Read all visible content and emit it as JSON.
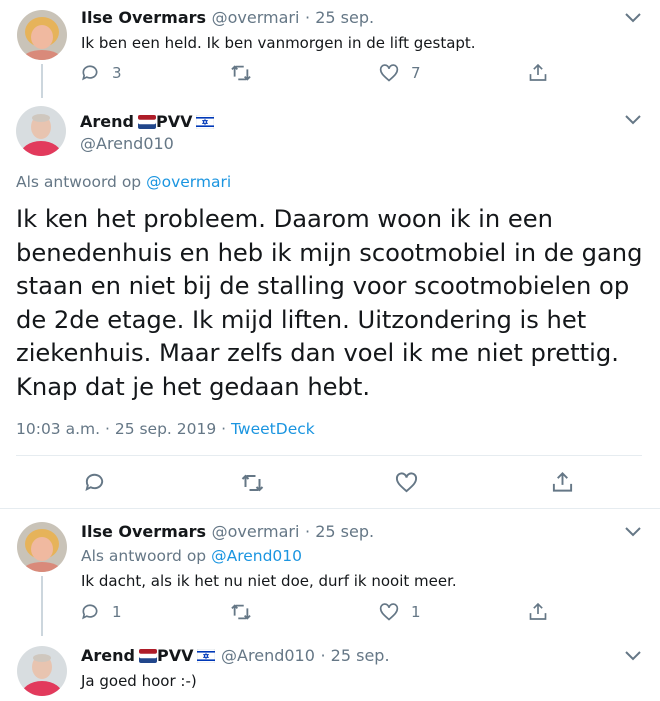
{
  "reply1": {
    "name": "Ilse Overmars",
    "handle": "@overmari",
    "date": "· 25 sep.",
    "text": "Ik ben een held. Ik ben vanmorgen in de lift gestapt.",
    "replies": "3",
    "likes": "7"
  },
  "main": {
    "name": "Arend",
    "name_suffix": "PVV",
    "handle": "@Arend010",
    "reply_prefix": "Als antwoord op",
    "reply_to": "@overmari",
    "text": "Ik ken het probleem. Daarom woon ik in een benedenhuis en heb ik mijn scootmobiel in de gang staan en niet bij de stalling voor scootmobielen op de 2de  etage. Ik mijd liften. Uitzondering is het ziekenhuis. Maar zelfs dan voel ik me niet prettig. Knap dat je het gedaan hebt.",
    "timestamp": "10:03 a.m. · 25 sep. 2019 ·",
    "source": "TweetDeck"
  },
  "reply2": {
    "name": "Ilse Overmars",
    "handle": "@overmari",
    "date": "· 25 sep.",
    "reply_prefix": "Als antwoord op",
    "reply_to": "@Arend010",
    "text": "Ik dacht, als ik het nu niet doe, durf ik nooit meer.",
    "replies": "1",
    "likes": "1"
  },
  "reply3": {
    "name": "Arend",
    "name_suffix": "PVV",
    "handle": "@Arend010",
    "date": "· 25 sep.",
    "text": "Ja goed hoor :-)"
  },
  "colors": {
    "text": "#14171a",
    "secondary": "#657786",
    "link": "#1b95e0",
    "divider": "#e6ecf0",
    "thread_line": "#ccd6dd"
  }
}
